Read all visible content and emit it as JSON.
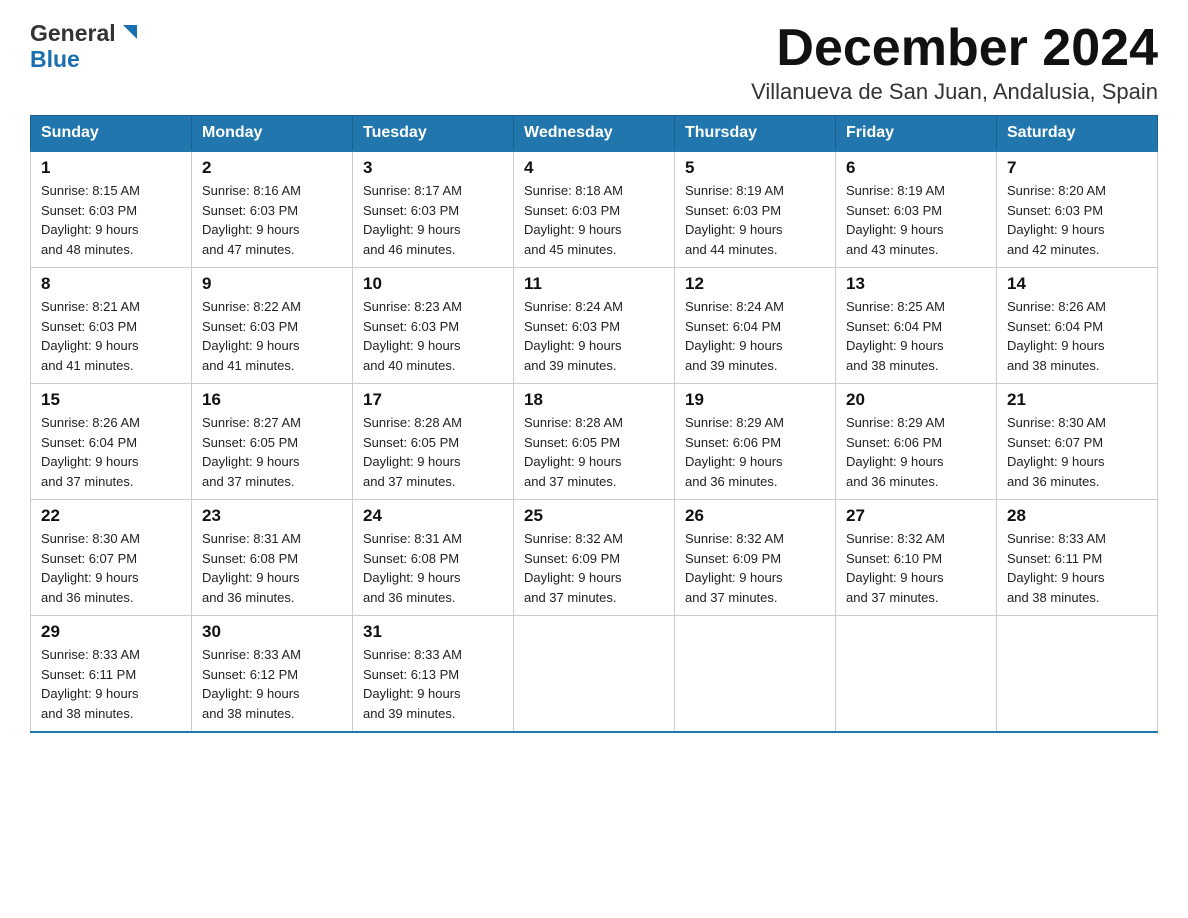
{
  "header": {
    "month_title": "December 2024",
    "location": "Villanueva de San Juan, Andalusia, Spain",
    "logo_general": "General",
    "logo_blue": "Blue"
  },
  "weekdays": [
    "Sunday",
    "Monday",
    "Tuesday",
    "Wednesday",
    "Thursday",
    "Friday",
    "Saturday"
  ],
  "weeks": [
    [
      {
        "day": "1",
        "sunrise": "8:15 AM",
        "sunset": "6:03 PM",
        "daylight": "9 hours and 48 minutes."
      },
      {
        "day": "2",
        "sunrise": "8:16 AM",
        "sunset": "6:03 PM",
        "daylight": "9 hours and 47 minutes."
      },
      {
        "day": "3",
        "sunrise": "8:17 AM",
        "sunset": "6:03 PM",
        "daylight": "9 hours and 46 minutes."
      },
      {
        "day": "4",
        "sunrise": "8:18 AM",
        "sunset": "6:03 PM",
        "daylight": "9 hours and 45 minutes."
      },
      {
        "day": "5",
        "sunrise": "8:19 AM",
        "sunset": "6:03 PM",
        "daylight": "9 hours and 44 minutes."
      },
      {
        "day": "6",
        "sunrise": "8:19 AM",
        "sunset": "6:03 PM",
        "daylight": "9 hours and 43 minutes."
      },
      {
        "day": "7",
        "sunrise": "8:20 AM",
        "sunset": "6:03 PM",
        "daylight": "9 hours and 42 minutes."
      }
    ],
    [
      {
        "day": "8",
        "sunrise": "8:21 AM",
        "sunset": "6:03 PM",
        "daylight": "9 hours and 41 minutes."
      },
      {
        "day": "9",
        "sunrise": "8:22 AM",
        "sunset": "6:03 PM",
        "daylight": "9 hours and 41 minutes."
      },
      {
        "day": "10",
        "sunrise": "8:23 AM",
        "sunset": "6:03 PM",
        "daylight": "9 hours and 40 minutes."
      },
      {
        "day": "11",
        "sunrise": "8:24 AM",
        "sunset": "6:03 PM",
        "daylight": "9 hours and 39 minutes."
      },
      {
        "day": "12",
        "sunrise": "8:24 AM",
        "sunset": "6:04 PM",
        "daylight": "9 hours and 39 minutes."
      },
      {
        "day": "13",
        "sunrise": "8:25 AM",
        "sunset": "6:04 PM",
        "daylight": "9 hours and 38 minutes."
      },
      {
        "day": "14",
        "sunrise": "8:26 AM",
        "sunset": "6:04 PM",
        "daylight": "9 hours and 38 minutes."
      }
    ],
    [
      {
        "day": "15",
        "sunrise": "8:26 AM",
        "sunset": "6:04 PM",
        "daylight": "9 hours and 37 minutes."
      },
      {
        "day": "16",
        "sunrise": "8:27 AM",
        "sunset": "6:05 PM",
        "daylight": "9 hours and 37 minutes."
      },
      {
        "day": "17",
        "sunrise": "8:28 AM",
        "sunset": "6:05 PM",
        "daylight": "9 hours and 37 minutes."
      },
      {
        "day": "18",
        "sunrise": "8:28 AM",
        "sunset": "6:05 PM",
        "daylight": "9 hours and 37 minutes."
      },
      {
        "day": "19",
        "sunrise": "8:29 AM",
        "sunset": "6:06 PM",
        "daylight": "9 hours and 36 minutes."
      },
      {
        "day": "20",
        "sunrise": "8:29 AM",
        "sunset": "6:06 PM",
        "daylight": "9 hours and 36 minutes."
      },
      {
        "day": "21",
        "sunrise": "8:30 AM",
        "sunset": "6:07 PM",
        "daylight": "9 hours and 36 minutes."
      }
    ],
    [
      {
        "day": "22",
        "sunrise": "8:30 AM",
        "sunset": "6:07 PM",
        "daylight": "9 hours and 36 minutes."
      },
      {
        "day": "23",
        "sunrise": "8:31 AM",
        "sunset": "6:08 PM",
        "daylight": "9 hours and 36 minutes."
      },
      {
        "day": "24",
        "sunrise": "8:31 AM",
        "sunset": "6:08 PM",
        "daylight": "9 hours and 36 minutes."
      },
      {
        "day": "25",
        "sunrise": "8:32 AM",
        "sunset": "6:09 PM",
        "daylight": "9 hours and 37 minutes."
      },
      {
        "day": "26",
        "sunrise": "8:32 AM",
        "sunset": "6:09 PM",
        "daylight": "9 hours and 37 minutes."
      },
      {
        "day": "27",
        "sunrise": "8:32 AM",
        "sunset": "6:10 PM",
        "daylight": "9 hours and 37 minutes."
      },
      {
        "day": "28",
        "sunrise": "8:33 AM",
        "sunset": "6:11 PM",
        "daylight": "9 hours and 38 minutes."
      }
    ],
    [
      {
        "day": "29",
        "sunrise": "8:33 AM",
        "sunset": "6:11 PM",
        "daylight": "9 hours and 38 minutes."
      },
      {
        "day": "30",
        "sunrise": "8:33 AM",
        "sunset": "6:12 PM",
        "daylight": "9 hours and 38 minutes."
      },
      {
        "day": "31",
        "sunrise": "8:33 AM",
        "sunset": "6:13 PM",
        "daylight": "9 hours and 39 minutes."
      },
      null,
      null,
      null,
      null
    ]
  ],
  "labels": {
    "sunrise_prefix": "Sunrise: ",
    "sunset_prefix": "Sunset: ",
    "daylight_prefix": "Daylight: "
  }
}
